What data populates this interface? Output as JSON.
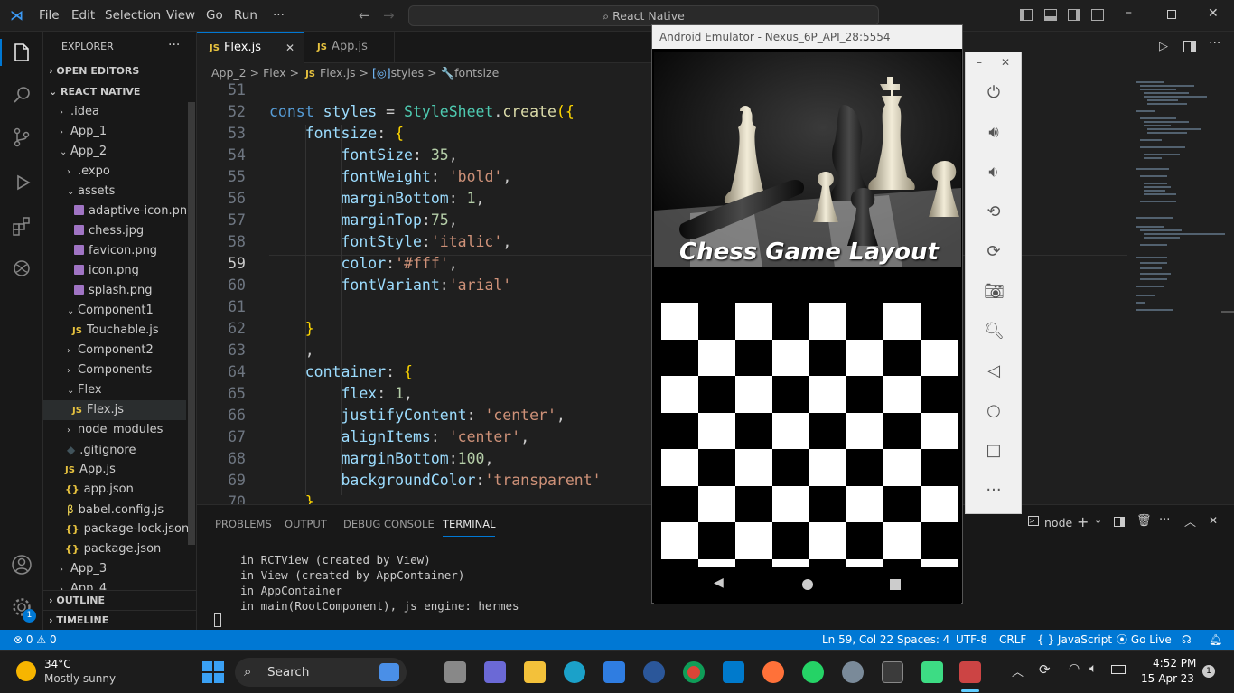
{
  "titlebar": {
    "menu": [
      "File",
      "Edit",
      "Selection",
      "View",
      "Go",
      "Run",
      "···"
    ],
    "search": "React Native"
  },
  "sidebar": {
    "title": "EXPLORER",
    "more": "···",
    "sections": {
      "open_editors": "OPEN EDITORS",
      "project": "REACT NATIVE",
      "outline": "OUTLINE",
      "timeline": "TIMELINE"
    },
    "items": [
      {
        "label": ".idea",
        "chev": "›"
      },
      {
        "label": "App_1",
        "chev": "›"
      },
      {
        "label": "App_2",
        "chev": "⌄"
      },
      {
        "label": ".expo",
        "chev": "›"
      },
      {
        "label": "assets",
        "chev": "⌄"
      },
      {
        "label": "adaptive-icon.png"
      },
      {
        "label": "chess.jpg"
      },
      {
        "label": "favicon.png"
      },
      {
        "label": "icon.png"
      },
      {
        "label": "splash.png"
      },
      {
        "label": "Component1",
        "chev": "⌄"
      },
      {
        "label": "Touchable.js",
        "badge": "JS"
      },
      {
        "label": "Component2",
        "chev": "›"
      },
      {
        "label": "Components",
        "chev": "›"
      },
      {
        "label": "Flex",
        "chev": "⌄"
      },
      {
        "label": "Flex.js",
        "badge": "JS"
      },
      {
        "label": "node_modules",
        "chev": "›"
      },
      {
        "label": ".gitignore"
      },
      {
        "label": "App.js",
        "badge": "JS"
      },
      {
        "label": "app.json",
        "badge": "{}"
      },
      {
        "label": "babel.config.js"
      },
      {
        "label": "package-lock.json",
        "badge": "{}"
      },
      {
        "label": "package.json",
        "badge": "{}"
      },
      {
        "label": "App_3",
        "chev": "›"
      },
      {
        "label": "App_4",
        "chev": "›"
      }
    ]
  },
  "tabs": [
    {
      "label": "Flex.js",
      "badge": "JS",
      "close": "✕"
    },
    {
      "label": "App.js",
      "badge": "JS"
    }
  ],
  "breadcrumb": {
    "p1": "App_2",
    "p2": "Flex",
    "p3": "Flex.js",
    "p4": "styles",
    "p5": "fontsize",
    "sep": ">"
  },
  "code": {
    "line_numbers": [
      "51",
      "52",
      "53",
      "54",
      "55",
      "56",
      "57",
      "58",
      "59",
      "60",
      "61",
      "62",
      "63",
      "64",
      "65",
      "66",
      "67",
      "68",
      "69",
      "70"
    ],
    "lines": [
      "",
      "const styles = StyleSheet.create({",
      "    fontsize: {",
      "        fontSize: 35,",
      "        fontWeight: 'bold',",
      "        marginBottom: 1,",
      "        marginTop:75,",
      "        fontStyle:'italic',",
      "        color:'#fff',",
      "        fontVariant:'arial'",
      "",
      "    }",
      "    ,",
      "    container: {",
      "        flex: 1,",
      "        justifyContent: 'center',",
      "        alignItems: 'center',",
      "        marginBottom:100,",
      "        backgroundColor:'transparent'",
      "    }"
    ]
  },
  "panel": {
    "tabs": [
      "PROBLEMS",
      "OUTPUT",
      "DEBUG CONSOLE",
      "TERMINAL"
    ],
    "terminal_name": "node",
    "lines": [
      "in RCTView (created by View)",
      "in View (created by AppContainer)",
      "in AppContainer",
      "in main(RootComponent), js engine: hermes"
    ]
  },
  "emulator": {
    "title": "Android Emulator - Nexus_6P_API_28:5554",
    "app_title": "Chess Game Layout",
    "min": "–",
    "close": "✕"
  },
  "statusbar": {
    "errors": "0",
    "warnings": "0",
    "position": "Ln 59, Col 22",
    "spaces": "Spaces: 4",
    "encoding": "UTF-8",
    "eol": "CRLF",
    "language": "JavaScript",
    "golive": "Go Live"
  },
  "taskbar": {
    "weather_temp": "34°C",
    "weather_desc": "Mostly sunny",
    "search": "Search",
    "time": "4:52 PM",
    "date": "15-Apr-23",
    "notif": "1"
  },
  "colors": {
    "accent": "#0078d4",
    "keyword": "#569cd6",
    "string": "#ce9178",
    "number": "#b5cea8",
    "property": "#9cdcfe",
    "class": "#4ec9b0",
    "function": "#dcdcaa"
  }
}
